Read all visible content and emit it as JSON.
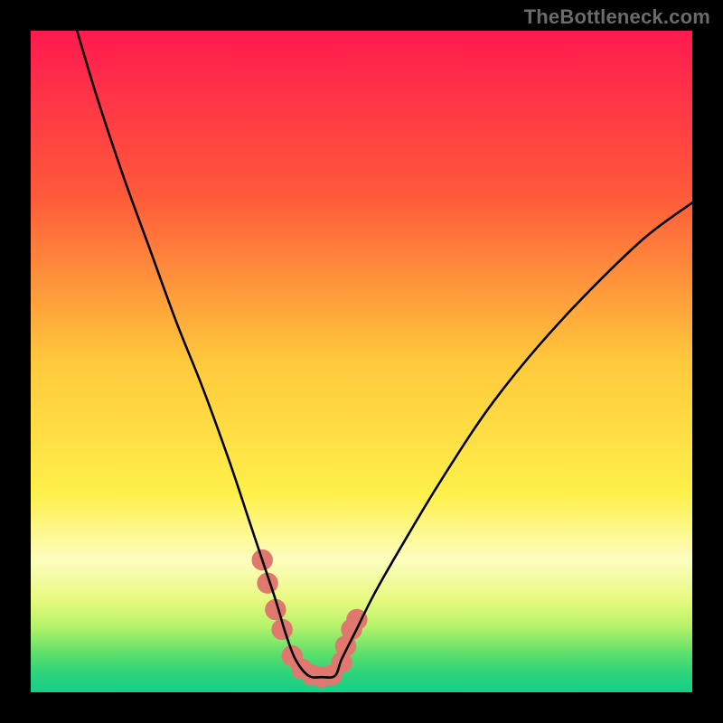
{
  "watermark": "TheBottleneck.com",
  "chart_data": {
    "type": "line",
    "title": "",
    "xlabel": "",
    "ylabel": "",
    "xlim": [
      0,
      100
    ],
    "ylim": [
      0,
      100
    ],
    "grid": false,
    "legend": false,
    "background_gradient_stops": [
      {
        "pct": 0,
        "color": "#ff1a4f"
      },
      {
        "pct": 25,
        "color": "#ff5a3a"
      },
      {
        "pct": 50,
        "color": "#ffc93c"
      },
      {
        "pct": 70,
        "color": "#fff04a"
      },
      {
        "pct": 80,
        "color": "#fdfec0"
      },
      {
        "pct": 86,
        "color": "#e8f97f"
      },
      {
        "pct": 90,
        "color": "#b6f36a"
      },
      {
        "pct": 94,
        "color": "#5fe06a"
      },
      {
        "pct": 97,
        "color": "#2fd47a"
      },
      {
        "pct": 100,
        "color": "#14cf88"
      }
    ],
    "series": [
      {
        "name": "bottleneck-curve",
        "color": "#000000",
        "x": [
          7,
          10,
          14,
          18,
          22,
          26,
          30,
          33,
          35,
          37,
          38.5,
          40,
          42,
          44,
          46,
          47,
          49,
          52,
          56,
          62,
          70,
          80,
          92,
          100
        ],
        "values": [
          100,
          90,
          78,
          67,
          56,
          46,
          35,
          26,
          20,
          14,
          9,
          5,
          2.5,
          2.3,
          2.5,
          5,
          9,
          15,
          22,
          32,
          44,
          56,
          68,
          74
        ]
      }
    ],
    "markers": {
      "name": "highlight-dots",
      "color": "#e07870",
      "radius_pct": 1.6,
      "points": [
        {
          "x": 35.0,
          "y": 20.0
        },
        {
          "x": 35.8,
          "y": 16.5
        },
        {
          "x": 37.0,
          "y": 12.5
        },
        {
          "x": 38.0,
          "y": 9.5
        },
        {
          "x": 39.5,
          "y": 5.5
        },
        {
          "x": 41.0,
          "y": 3.5
        },
        {
          "x": 42.5,
          "y": 2.6
        },
        {
          "x": 44.0,
          "y": 2.3
        },
        {
          "x": 45.5,
          "y": 2.6
        },
        {
          "x": 47.0,
          "y": 4.5
        },
        {
          "x": 47.6,
          "y": 7.0
        },
        {
          "x": 48.5,
          "y": 9.5
        },
        {
          "x": 49.3,
          "y": 11.0
        }
      ]
    }
  }
}
